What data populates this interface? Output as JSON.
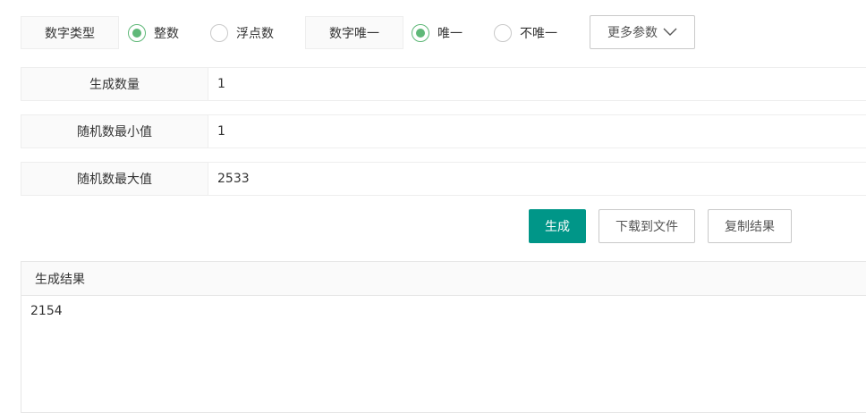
{
  "number_type": {
    "label": "数字类型",
    "options": [
      {
        "label": "整数",
        "checked": true
      },
      {
        "label": "浮点数",
        "checked": false
      }
    ]
  },
  "unique": {
    "label": "数字唯一",
    "options": [
      {
        "label": "唯一",
        "checked": true
      },
      {
        "label": "不唯一",
        "checked": false
      }
    ]
  },
  "more_params": {
    "label": "更多参数",
    "icon": "chevron-down-icon"
  },
  "fields": [
    {
      "label": "生成数量",
      "value": "1"
    },
    {
      "label": "随机数最小值",
      "value": "1"
    },
    {
      "label": "随机数最大值",
      "value": "2533"
    }
  ],
  "actions": {
    "generate": "生成",
    "download": "下载到文件",
    "copy": "复制结果"
  },
  "result": {
    "title": "生成结果",
    "value": "2154"
  },
  "colors": {
    "primary": "#009688",
    "radio": "#5fb878"
  }
}
